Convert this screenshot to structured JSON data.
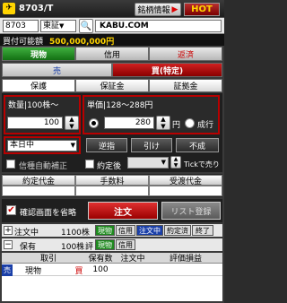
{
  "window": {
    "title": "8703/T"
  },
  "topbar": {
    "info_label": "銘柄情報",
    "hot_label": "HOT"
  },
  "symbolbar": {
    "code": "8703",
    "market": "東証",
    "site": "KABU.COM"
  },
  "account": {
    "label": "買付可能額",
    "amount": "500,000,000円"
  },
  "tabs_type": [
    {
      "label": "現物"
    },
    {
      "label": "信用"
    },
    {
      "label": "返済"
    }
  ],
  "tabs_side": [
    {
      "label": "売"
    },
    {
      "label": "買(特定)"
    }
  ],
  "tabs_account": [
    {
      "label": "保護"
    },
    {
      "label": "保証金"
    },
    {
      "label": "証拠金"
    }
  ],
  "quantity": {
    "label": "数量",
    "unit": "100株〜",
    "value": "100"
  },
  "price": {
    "label": "単価",
    "range": "128〜288円",
    "value": "280",
    "unit": "円",
    "market_label": "成行"
  },
  "condition": {
    "value": "本日中"
  },
  "order_buttons": [
    "逆指",
    "引け",
    "不成"
  ],
  "auto_correct": {
    "label": "信種自動補正"
  },
  "execution": {
    "label": "約定後",
    "tick_label": "Tickで売り"
  },
  "totals": {
    "headers": [
      "約定代金",
      "手数料",
      "受渡代金"
    ]
  },
  "confirm": {
    "label": "確認画面を省略"
  },
  "order_button": "注文",
  "list_button": "リスト登録",
  "order_row": {
    "label": "注文中",
    "count": "1100株",
    "badges": [
      "現物",
      "信用",
      "注文中",
      "約定済",
      "終了"
    ]
  },
  "holdings_row": {
    "label": "保有",
    "count": "100株",
    "badge": "評",
    "badges": [
      "現物",
      "信用"
    ]
  },
  "holdings_table": {
    "headers": [
      "取引",
      "保有数",
      "注文中",
      "評価損益"
    ],
    "rows": [
      {
        "side": "売",
        "type": "現物",
        "flag": "買",
        "qty": "100",
        "pending": "",
        "pl": ""
      }
    ]
  },
  "colors": {
    "accent_green": "#1e8a1e",
    "accent_red": "#b80000",
    "accent_blue": "#1a3fa8"
  }
}
